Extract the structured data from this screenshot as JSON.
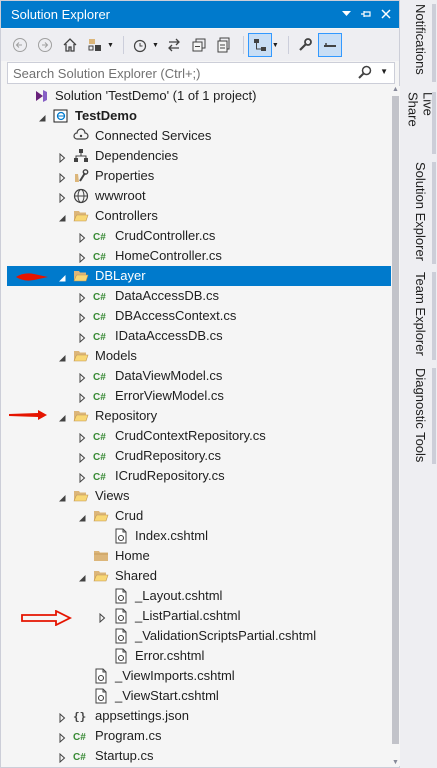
{
  "panel": {
    "title": "Solution Explorer",
    "title_buttons": [
      "dropdown-arrow-icon",
      "pin-icon",
      "close-icon"
    ]
  },
  "toolbar": {
    "buttons": [
      "back-icon",
      "forward-icon",
      "home-icon",
      "switch-views-icon",
      "history-icon",
      "sync-icon",
      "collapse-all-icon",
      "show-all-files-icon",
      "preview-selected-icon",
      "properties-icon",
      "pending-changes-icon"
    ]
  },
  "search": {
    "placeholder": "Search Solution Explorer (Ctrl+;)"
  },
  "tree": [
    {
      "label": "Solution 'TestDemo' (1 of 1 project)",
      "icon": "solution-icon",
      "expander": "none"
    },
    {
      "label": "TestDemo",
      "icon": "web-project-icon",
      "expander": "expanded",
      "bold": true
    },
    {
      "label": "Connected Services",
      "icon": "connected-services-icon",
      "expander": "none"
    },
    {
      "label": "Dependencies",
      "icon": "dependencies-icon",
      "expander": "collapsed"
    },
    {
      "label": "Properties",
      "icon": "properties-wrench-icon",
      "expander": "collapsed"
    },
    {
      "label": "wwwroot",
      "icon": "globe-icon",
      "expander": "collapsed"
    },
    {
      "label": "Controllers",
      "icon": "folder-open-icon",
      "expander": "expanded"
    },
    {
      "label": "CrudController.cs",
      "icon": "csharp-file-icon",
      "expander": "collapsed"
    },
    {
      "label": "HomeController.cs",
      "icon": "csharp-file-icon",
      "expander": "collapsed"
    },
    {
      "label": "DBLayer",
      "icon": "folder-open-icon",
      "expander": "expanded",
      "selected": true
    },
    {
      "label": "DataAccessDB.cs",
      "icon": "csharp-file-icon",
      "expander": "collapsed"
    },
    {
      "label": "DBAccessContext.cs",
      "icon": "csharp-file-icon",
      "expander": "collapsed"
    },
    {
      "label": "IDataAccessDB.cs",
      "icon": "csharp-file-icon",
      "expander": "collapsed"
    },
    {
      "label": "Models",
      "icon": "folder-open-icon",
      "expander": "expanded"
    },
    {
      "label": "DataViewModel.cs",
      "icon": "csharp-file-icon",
      "expander": "collapsed"
    },
    {
      "label": "ErrorViewModel.cs",
      "icon": "csharp-file-icon",
      "expander": "collapsed"
    },
    {
      "label": "Repository",
      "icon": "folder-open-icon",
      "expander": "expanded"
    },
    {
      "label": "CrudContextRepository.cs",
      "icon": "csharp-file-icon",
      "expander": "collapsed"
    },
    {
      "label": "CrudRepository.cs",
      "icon": "csharp-file-icon",
      "expander": "collapsed"
    },
    {
      "label": "ICrudRepository.cs",
      "icon": "csharp-file-icon",
      "expander": "collapsed"
    },
    {
      "label": "Views",
      "icon": "folder-open-icon",
      "expander": "expanded"
    },
    {
      "label": "Crud",
      "icon": "folder-open-icon",
      "expander": "expanded"
    },
    {
      "label": "Index.cshtml",
      "icon": "razor-file-icon",
      "expander": "none"
    },
    {
      "label": "Home",
      "icon": "folder-closed-icon",
      "expander": "none"
    },
    {
      "label": "Shared",
      "icon": "folder-open-icon",
      "expander": "expanded"
    },
    {
      "label": "_Layout.cshtml",
      "icon": "razor-file-icon",
      "expander": "none"
    },
    {
      "label": "_ListPartial.cshtml",
      "icon": "razor-file-icon",
      "expander": "collapsed"
    },
    {
      "label": "_ValidationScriptsPartial.cshtml",
      "icon": "razor-file-icon",
      "expander": "none"
    },
    {
      "label": "Error.cshtml",
      "icon": "razor-file-icon",
      "expander": "none"
    },
    {
      "label": "_ViewImports.cshtml",
      "icon": "razor-file-icon",
      "expander": "none"
    },
    {
      "label": "_ViewStart.cshtml",
      "icon": "razor-file-icon",
      "expander": "none"
    },
    {
      "label": "appsettings.json",
      "icon": "json-file-icon",
      "expander": "collapsed"
    },
    {
      "label": "Program.cs",
      "icon": "csharp-file-icon",
      "expander": "collapsed"
    },
    {
      "label": "Startup.cs",
      "icon": "csharp-file-icon",
      "expander": "collapsed"
    }
  ],
  "side_tabs": [
    "Notifications",
    "Live Share",
    "Solution Explorer",
    "Team Explorer",
    "Diagnostic Tools"
  ],
  "colors": {
    "accent": "#007acc",
    "selection": "#007acc",
    "csharp": "#388a34",
    "folder": "#dcb67a",
    "annotation_red": "#e51400"
  }
}
